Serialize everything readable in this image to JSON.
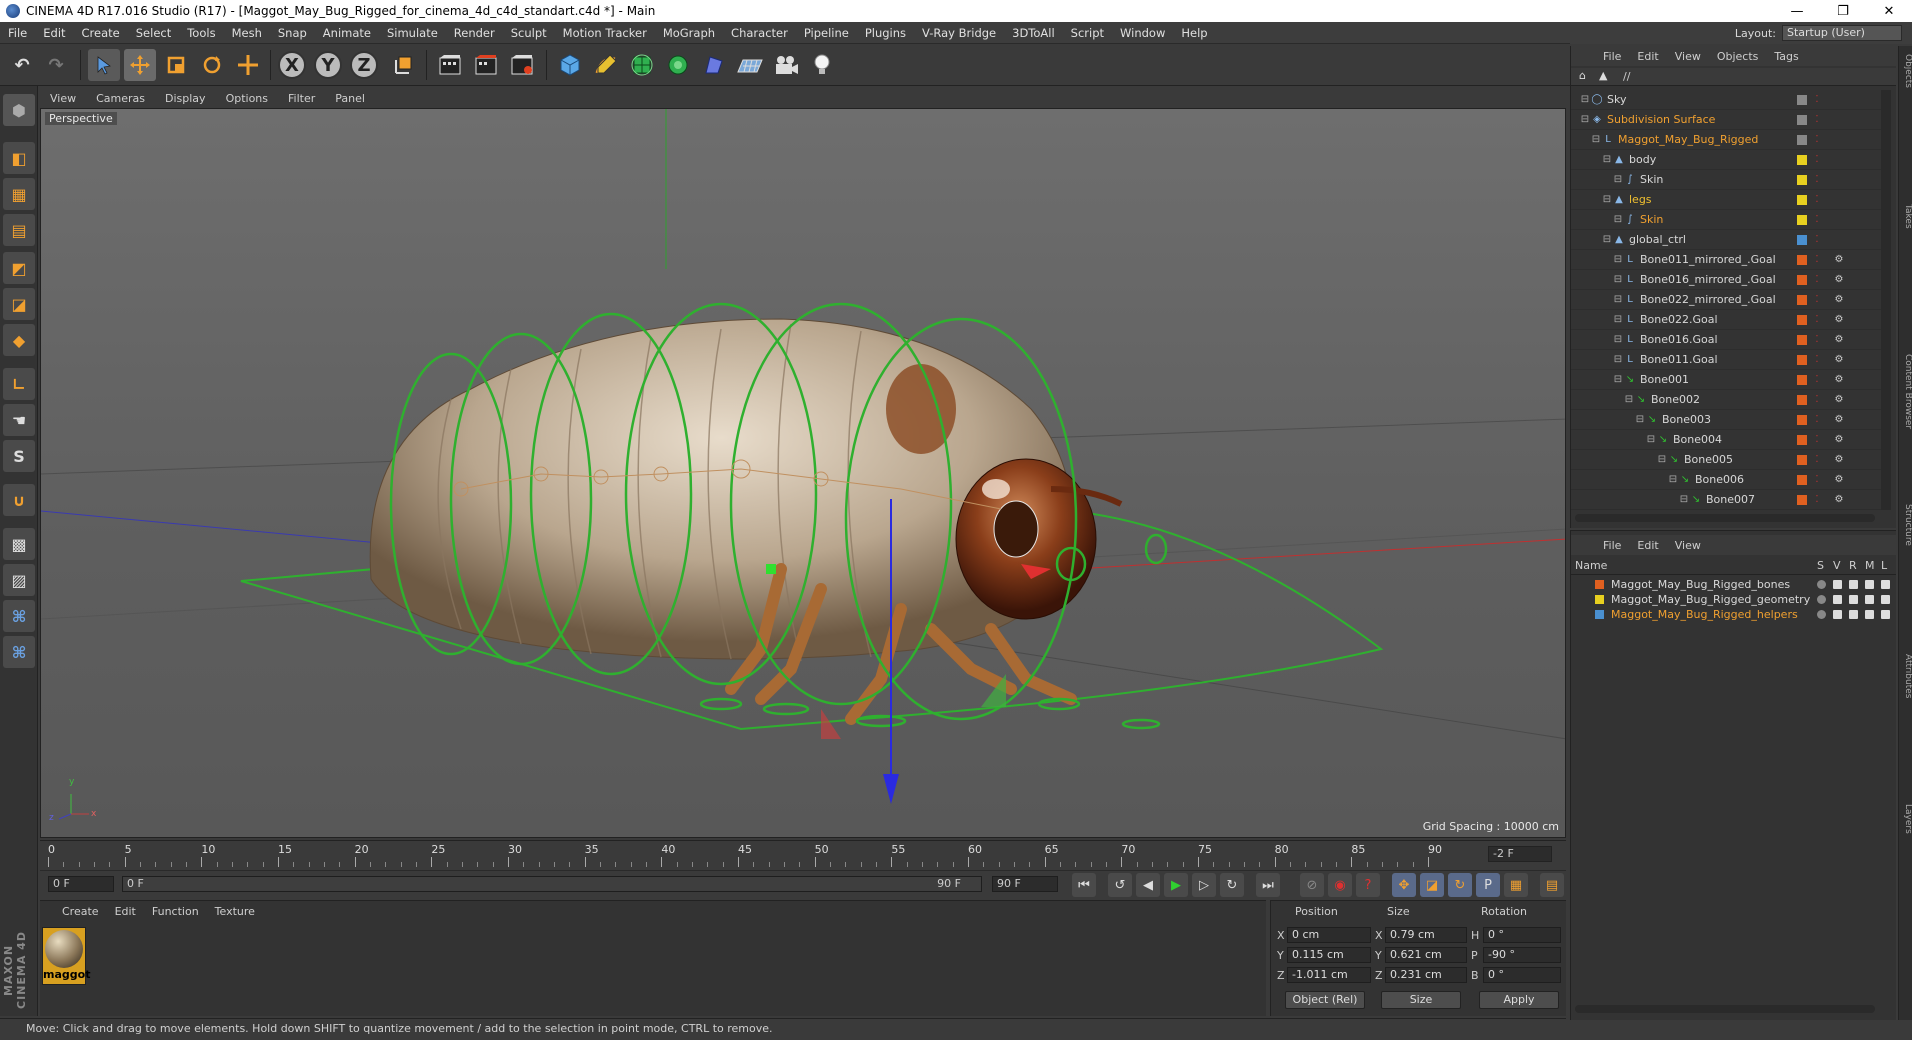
{
  "window": {
    "title": "CINEMA 4D R17.016 Studio (R17) - [Maggot_May_Bug_Rigged_for_cinema_4d_c4d_standart.c4d *] - Main",
    "minimize": "—",
    "maximize": "❐",
    "close": "✕"
  },
  "menubar": [
    "File",
    "Edit",
    "Create",
    "Select",
    "Tools",
    "Mesh",
    "Snap",
    "Animate",
    "Simulate",
    "Render",
    "Sculpt",
    "Motion Tracker",
    "MoGraph",
    "Character",
    "Pipeline",
    "Plugins",
    "V-Ray Bridge",
    "3DToAll",
    "Script",
    "Window",
    "Help"
  ],
  "layout": {
    "label": "Layout:",
    "value": "Startup (User)"
  },
  "toolbar": {
    "undo": "↶",
    "redo": "↷",
    "x_axis": "X",
    "y_axis": "Y",
    "z_axis": "Z"
  },
  "viewport": {
    "menu": [
      "View",
      "Cameras",
      "Display",
      "Options",
      "Filter",
      "Panel"
    ],
    "camera_label": "Perspective",
    "grid_spacing": "Grid Spacing : 10000 cm",
    "axis_y": "y",
    "axis_z": "z",
    "axis_x": "x"
  },
  "timeline": {
    "ticks": [
      "0",
      "5",
      "10",
      "15",
      "20",
      "25",
      "30",
      "35",
      "40",
      "45",
      "50",
      "55",
      "60",
      "65",
      "70",
      "75",
      "80",
      "85",
      "90"
    ],
    "current_frame": "-2 F"
  },
  "playback": {
    "start_field": "0 F",
    "range_start": "0 F",
    "range_end": "90 F",
    "end_field": "90 F"
  },
  "material_manager": {
    "menu": [
      "Create",
      "Edit",
      "Function",
      "Texture"
    ],
    "materials": [
      {
        "name": "maggot"
      }
    ]
  },
  "coordinates": {
    "headers": {
      "position": "Position",
      "size": "Size",
      "rotation": "Rotation"
    },
    "rows": [
      {
        "pos_label": "X",
        "pos": "0 cm",
        "size_label": "X",
        "size": "0.79 cm",
        "rot_label": "H",
        "rot": "0 °"
      },
      {
        "pos_label": "Y",
        "pos": "0.115 cm",
        "size_label": "Y",
        "size": "0.621 cm",
        "rot_label": "P",
        "rot": "-90 °"
      },
      {
        "pos_label": "Z",
        "pos": "-1.011 cm",
        "size_label": "Z",
        "size": "0.231 cm",
        "rot_label": "B",
        "rot": "0 °"
      }
    ],
    "mode": "Object (Rel)",
    "size_mode": "Size",
    "apply": "Apply"
  },
  "status": "Move: Click and drag to move elements. Hold down SHIFT to quantize movement / add to the selection in point mode, CTRL to remove.",
  "maxon_logo": "MAXON CINEMA 4D",
  "object_manager": {
    "menu": [
      "File",
      "Edit",
      "View",
      "Objects",
      "Tags"
    ],
    "path": "//",
    "objects": [
      {
        "name": "Sky",
        "indent": 0,
        "color": "#d8d8d8",
        "tag": "#888888",
        "icon": "◯"
      },
      {
        "name": "Subdivision Surface",
        "indent": 0,
        "color": "#f0a030",
        "tag": "#888888",
        "icon": "◈"
      },
      {
        "name": "Maggot_May_Bug_Rigged",
        "indent": 1,
        "color": "#f0a030",
        "tag": "#888888",
        "icon": "L"
      },
      {
        "name": "body",
        "indent": 2,
        "color": "#d8d8d8",
        "tag": "#e8d020",
        "icon": "▲"
      },
      {
        "name": "Skin",
        "indent": 3,
        "color": "#d8d8d8",
        "tag": "#e8d020",
        "icon": "∫"
      },
      {
        "name": "legs",
        "indent": 2,
        "color": "#f0c030",
        "tag": "#e8d020",
        "icon": "▲"
      },
      {
        "name": "Skin",
        "indent": 3,
        "color": "#f0a030",
        "tag": "#e8d020",
        "icon": "∫"
      },
      {
        "name": "global_ctrl",
        "indent": 2,
        "color": "#d8d8d8",
        "tag": "#4a90d0",
        "icon": "▲"
      },
      {
        "name": "Bone011_mirrored_.Goal",
        "indent": 3,
        "color": "#d8d8d8",
        "tag": "#e06020",
        "icon": "L"
      },
      {
        "name": "Bone016_mirrored_.Goal",
        "indent": 3,
        "color": "#d8d8d8",
        "tag": "#e06020",
        "icon": "L"
      },
      {
        "name": "Bone022_mirrored_.Goal",
        "indent": 3,
        "color": "#d8d8d8",
        "tag": "#e06020",
        "icon": "L"
      },
      {
        "name": "Bone022.Goal",
        "indent": 3,
        "color": "#d8d8d8",
        "tag": "#e06020",
        "icon": "L"
      },
      {
        "name": "Bone016.Goal",
        "indent": 3,
        "color": "#d8d8d8",
        "tag": "#e06020",
        "icon": "L"
      },
      {
        "name": "Bone011.Goal",
        "indent": 3,
        "color": "#d8d8d8",
        "tag": "#e06020",
        "icon": "L"
      },
      {
        "name": "Bone001",
        "indent": 3,
        "color": "#d8d8d8",
        "tag": "#e06020",
        "icon": "↘"
      },
      {
        "name": "Bone002",
        "indent": 4,
        "color": "#d8d8d8",
        "tag": "#e06020",
        "icon": "↘"
      },
      {
        "name": "Bone003",
        "indent": 5,
        "color": "#d8d8d8",
        "tag": "#e06020",
        "icon": "↘"
      },
      {
        "name": "Bone004",
        "indent": 6,
        "color": "#d8d8d8",
        "tag": "#e06020",
        "icon": "↘"
      },
      {
        "name": "Bone005",
        "indent": 7,
        "color": "#d8d8d8",
        "tag": "#e06020",
        "icon": "↘"
      },
      {
        "name": "Bone006",
        "indent": 8,
        "color": "#d8d8d8",
        "tag": "#e06020",
        "icon": "↘"
      },
      {
        "name": "Bone007",
        "indent": 9,
        "color": "#d8d8d8",
        "tag": "#e06020",
        "icon": "↘"
      }
    ]
  },
  "layer_manager": {
    "menu": [
      "File",
      "Edit",
      "View"
    ],
    "columns": {
      "name": "Name",
      "s": "S",
      "v": "V",
      "r": "R",
      "m": "M",
      "l": "L"
    },
    "layers": [
      {
        "name": "Maggot_May_Bug_Rigged_bones",
        "color": "#e06020",
        "text_color": "#d8d8d8"
      },
      {
        "name": "Maggot_May_Bug_Rigged_geometry",
        "color": "#e8d020",
        "text_color": "#d8d8d8"
      },
      {
        "name": "Maggot_May_Bug_Rigged_helpers",
        "color": "#4a90d0",
        "text_color": "#f0a030"
      }
    ]
  },
  "right_tabs": [
    "Objects",
    "Takes",
    "Content Browser",
    "Structure",
    "Attributes",
    "Layers"
  ]
}
